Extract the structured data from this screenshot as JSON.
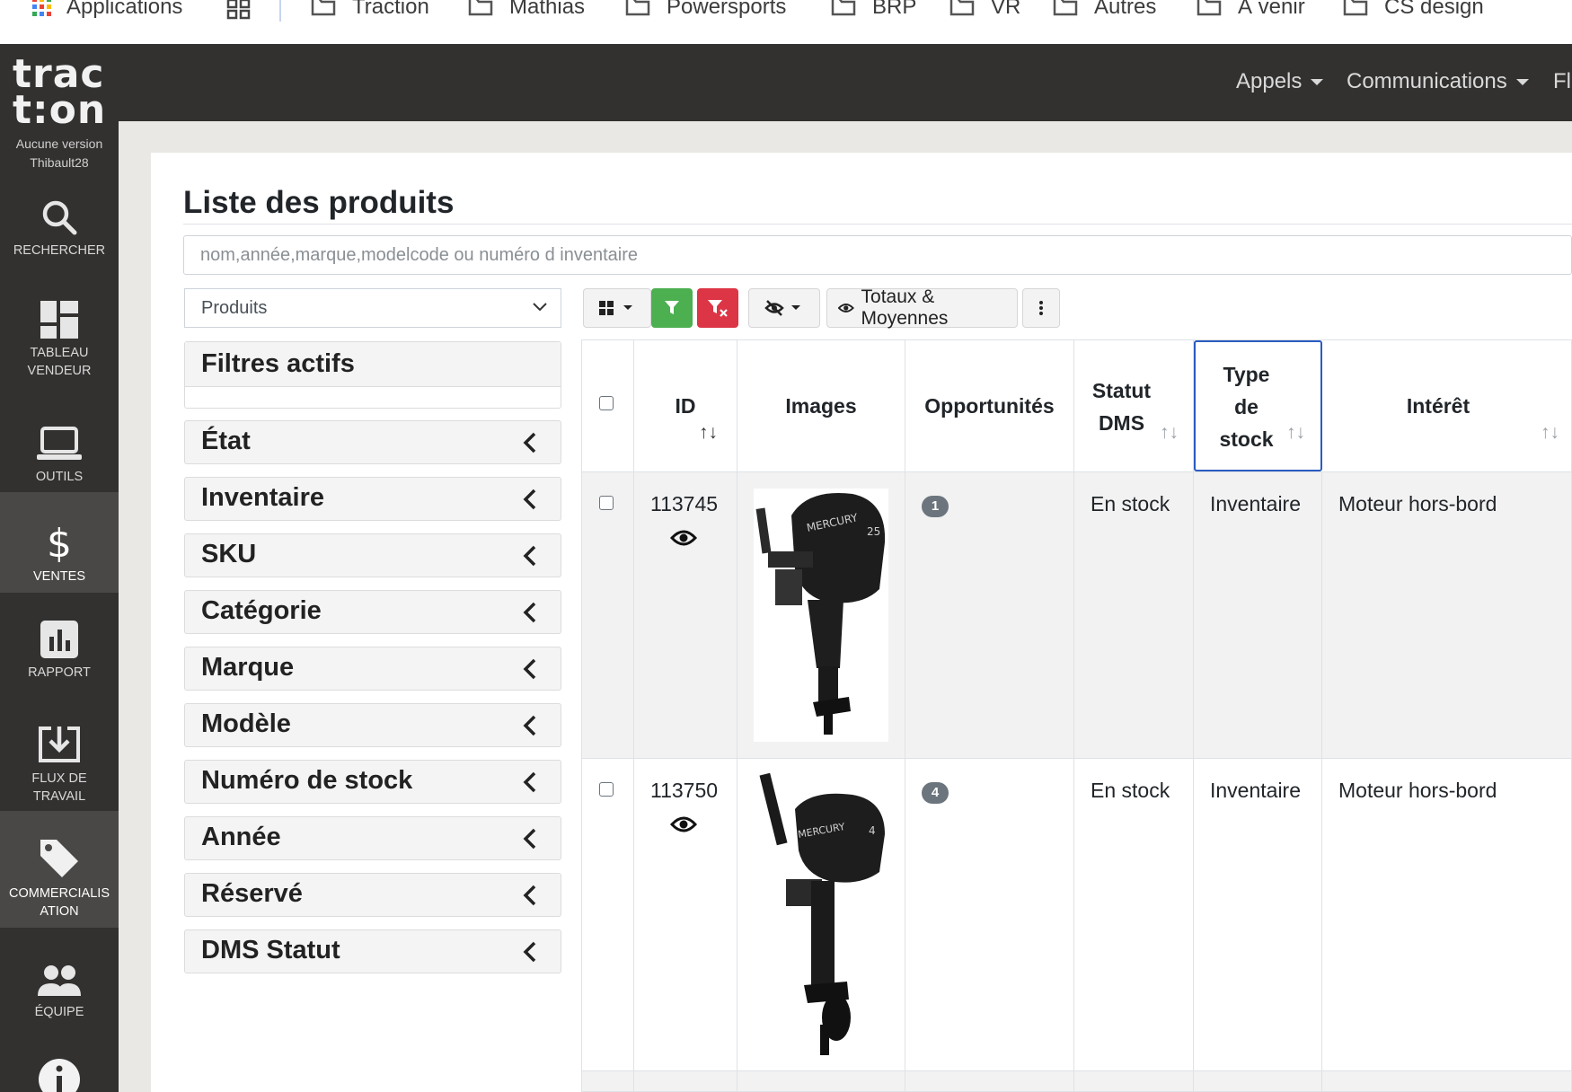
{
  "bookmarks": {
    "apps_label": "Applications",
    "items": [
      "Traction",
      "Mathias",
      "Powersports",
      "BRP",
      "VR",
      "Autres",
      "À venir",
      "CS design"
    ]
  },
  "brand": {
    "logo_line1": "trac",
    "logo_line2": "t:on",
    "version": "Aucune version",
    "user": "Thibault28"
  },
  "sidebar": {
    "items": [
      {
        "label_1": "RECHERCHER",
        "label_2": "",
        "icon": "search-icon"
      },
      {
        "label_1": "TABLEAU",
        "label_2": "VENDEUR",
        "icon": "dashboard-icon"
      },
      {
        "label_1": "OUTILS",
        "label_2": "",
        "icon": "laptop-icon"
      },
      {
        "label_1": "VENTES",
        "label_2": "",
        "icon": "dollar-icon"
      },
      {
        "label_1": "RAPPORT",
        "label_2": "",
        "icon": "bar-chart-icon"
      },
      {
        "label_1": "FLUX DE",
        "label_2": "TRAVAIL",
        "icon": "download-icon"
      },
      {
        "label_1": "COMMERCIALIS",
        "label_2": "ATION",
        "icon": "tag-icon"
      },
      {
        "label_1": "ÉQUIPE",
        "label_2": "",
        "icon": "team-icon"
      }
    ]
  },
  "topnav": {
    "menus": [
      "Appels",
      "Communications",
      "Fl"
    ]
  },
  "page": {
    "title": "Liste des produits",
    "search_placeholder": "nom,année,marque,modelcode ou numéro d inventaire",
    "category_select": "Produits"
  },
  "filters": {
    "active_title": "Filtres actifs",
    "items": [
      "État",
      "Inventaire",
      "SKU",
      "Catégorie",
      "Marque",
      "Modèle",
      "Numéro de stock",
      "Année",
      "Réservé",
      "DMS Statut"
    ]
  },
  "toolbar": {
    "totals_label": "Totaux & Moyennes",
    "colors": {
      "green": "#4caf50",
      "red": "#dc3545"
    }
  },
  "table": {
    "columns": {
      "id": "ID",
      "images": "Images",
      "opportunities": "Opportunités",
      "dms_1": "Statut",
      "dms_2": "DMS",
      "type_1": "Type",
      "type_2": "de",
      "type_3": "stock",
      "interest": "Intérêt"
    },
    "rows": [
      {
        "id": "113745",
        "image": "Mercury outboard motor 25",
        "opportunities": "1",
        "dms_status": "En stock",
        "stock_type": "Inventaire",
        "interest": "Moteur hors-bord"
      },
      {
        "id": "113750",
        "image": "Mercury outboard motor 4",
        "opportunities": "4",
        "dms_status": "En stock",
        "stock_type": "Inventaire",
        "interest": "Moteur hors-bord"
      }
    ]
  }
}
